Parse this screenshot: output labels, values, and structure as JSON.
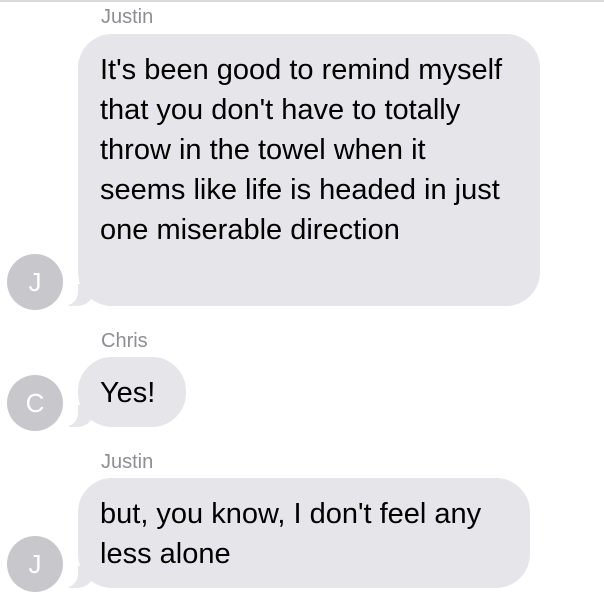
{
  "conversation": {
    "messages": [
      {
        "sender": "Justin",
        "avatar_initial": "J",
        "text": "It's been good to remind myself that you don't have to totally throw in the towel when it seems like life is headed in just one miserable direction"
      },
      {
        "sender": "Chris",
        "avatar_initial": "C",
        "text": "Yes!"
      },
      {
        "sender": "Justin",
        "avatar_initial": "J",
        "text": "but, you know, I don't feel any less alone"
      }
    ]
  },
  "colors": {
    "bubble_background": "#e5e5ea",
    "avatar_background": "#c7c7cc",
    "sender_name": "#8e8e93",
    "message_text": "#000000"
  }
}
